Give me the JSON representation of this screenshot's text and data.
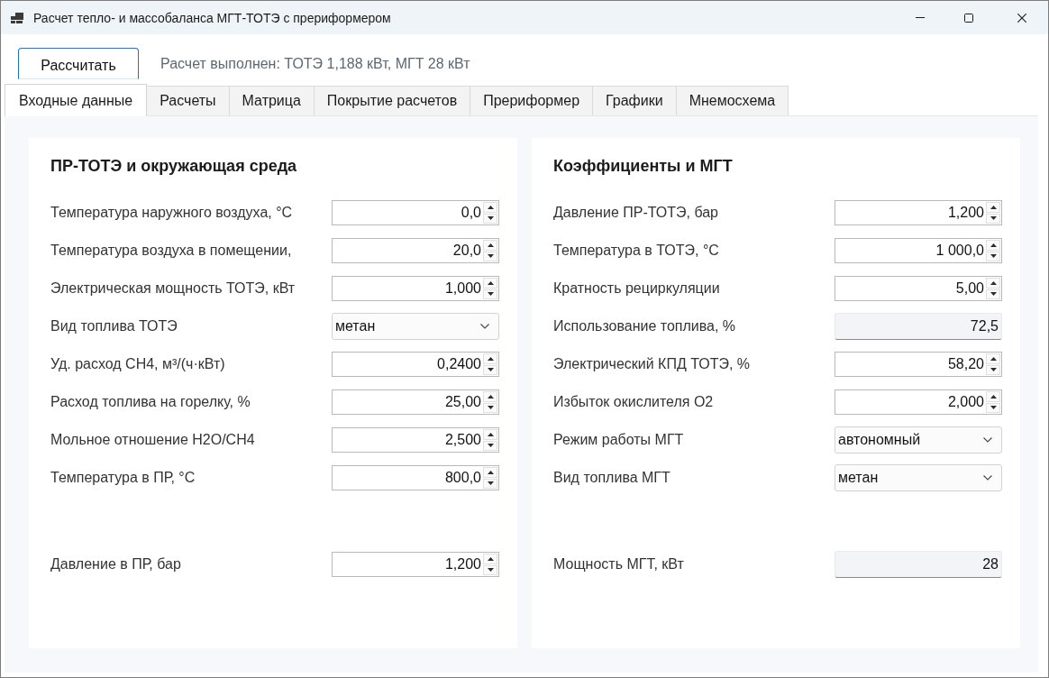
{
  "window": {
    "title": "Расчет тепло- и массобаланса МГТ-ТОТЭ с прериформером"
  },
  "toolbar": {
    "calculate_button": "Рассчитать",
    "status": "Расчет выполнен: ТОТЭ 1,188 кВт, МГТ 28 кВт"
  },
  "tabs": [
    {
      "label": "Входные данные",
      "selected": true
    },
    {
      "label": "Расчеты",
      "selected": false
    },
    {
      "label": "Матрица",
      "selected": false
    },
    {
      "label": "Покрытие расчетов",
      "selected": false
    },
    {
      "label": "Прериформер",
      "selected": false
    },
    {
      "label": "Графики",
      "selected": false
    },
    {
      "label": "Мнемосхема",
      "selected": false
    }
  ],
  "panels": [
    {
      "title": "ПР-ТОТЭ и окружающая среда",
      "rows": [
        {
          "kind": "spin",
          "label": "Температура наружного воздуха, °C",
          "value": "0,0"
        },
        {
          "kind": "spin",
          "label": "Температура воздуха в помещении,",
          "value": "20,0"
        },
        {
          "kind": "spin",
          "label": "Электрическая мощность ТОТЭ, кВт",
          "value": "1,000"
        },
        {
          "kind": "select",
          "label": "Вид топлива ТОТЭ",
          "value": "метан"
        },
        {
          "kind": "spin",
          "label": "Уд. расход CH4, м³/(ч·кВт)",
          "value": "0,2400"
        },
        {
          "kind": "spin",
          "label": "Расход топлива на горелку, %",
          "value": "25,00"
        },
        {
          "kind": "spin",
          "label": "Мольное отношение H2O/CH4",
          "value": "2,500"
        },
        {
          "kind": "spin",
          "label": "Температура в ПР, °C",
          "value": "800,0"
        }
      ],
      "bottom_rows": [
        {
          "kind": "spin",
          "label": "Давление в ПР, бар",
          "value": "1,200"
        }
      ]
    },
    {
      "title": "Коэффициенты и МГТ",
      "rows": [
        {
          "kind": "spin",
          "label": "Давление ПР-ТОТЭ, бар",
          "value": "1,200"
        },
        {
          "kind": "spin",
          "label": "Температура в ТОТЭ, °C",
          "value": "1 000,0"
        },
        {
          "kind": "spin",
          "label": "Кратность рециркуляции",
          "value": "5,00"
        },
        {
          "kind": "readonly",
          "label": "Использование топлива, %",
          "value": "72,5"
        },
        {
          "kind": "spin",
          "label": "Электрический КПД ТОТЭ, %",
          "value": "58,20"
        },
        {
          "kind": "spin",
          "label": "Избыток окислителя O2",
          "value": "2,000"
        },
        {
          "kind": "select",
          "label": "Режим работы МГТ",
          "value": "автономный"
        },
        {
          "kind": "select",
          "label": "Вид топлива МГТ",
          "value": "метан"
        }
      ],
      "bottom_rows": [
        {
          "kind": "readonly",
          "label": "Мощность МГТ, кВт",
          "value": "28"
        }
      ]
    }
  ]
}
